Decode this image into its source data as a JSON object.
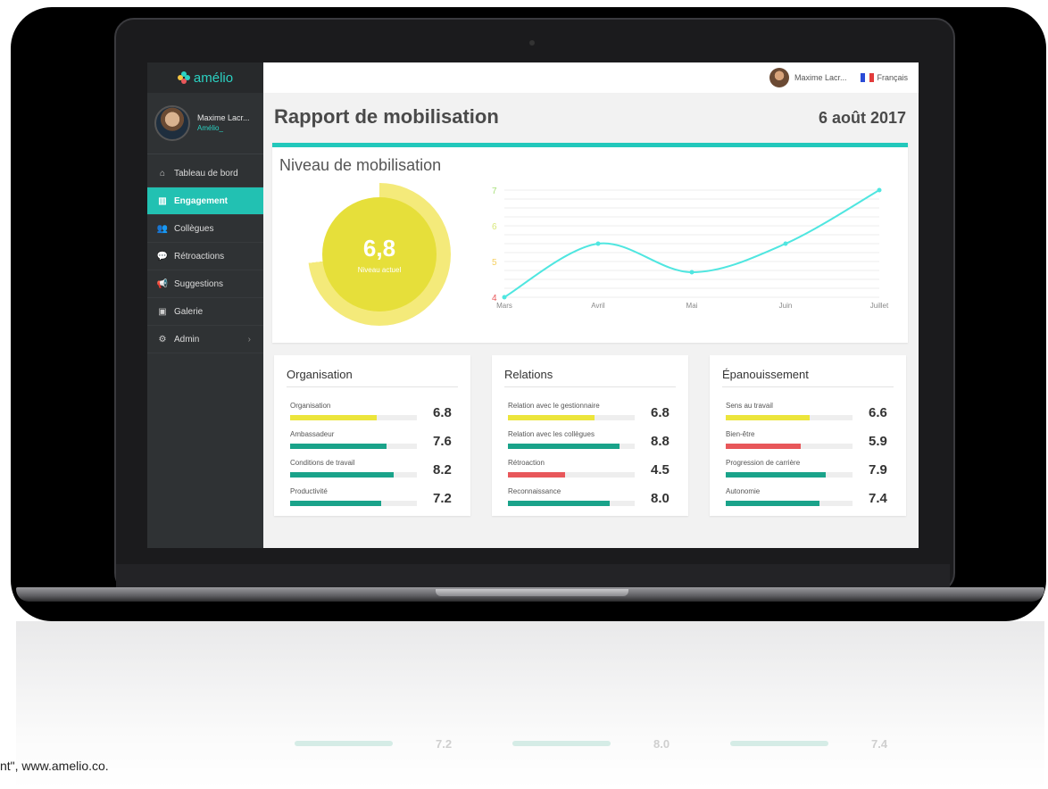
{
  "app": {
    "logo_text": "amélio"
  },
  "profile": {
    "name": "Maxime Lacr...",
    "org": "Amélio_"
  },
  "nav": [
    {
      "icon": "home-icon",
      "glyph": "⌂",
      "label": "Tableau de bord",
      "active": false
    },
    {
      "icon": "chart-icon",
      "glyph": "▥",
      "label": "Engagement",
      "active": true
    },
    {
      "icon": "users-icon",
      "glyph": "👥",
      "label": "Collègues",
      "active": false
    },
    {
      "icon": "comments-icon",
      "glyph": "💬",
      "label": "Rétroactions",
      "active": false
    },
    {
      "icon": "megaphone-icon",
      "glyph": "📢",
      "label": "Suggestions",
      "active": false
    },
    {
      "icon": "gallery-icon",
      "glyph": "▣",
      "label": "Galerie",
      "active": false
    },
    {
      "icon": "gear-icon",
      "glyph": "⚙",
      "label": "Admin",
      "active": false,
      "caret": "›"
    }
  ],
  "topbar": {
    "user": "Maxime Lacr...",
    "language": "Français"
  },
  "page": {
    "title": "Rapport de mobilisation",
    "date": "6 août 2017"
  },
  "mobilisation": {
    "heading": "Niveau de mobilisation",
    "current_value": "6,8",
    "current_label": "Niveau actuel",
    "gauge_fraction": 0.73
  },
  "chart_data": {
    "type": "line",
    "categories": [
      "Mars",
      "Avril",
      "Mai",
      "Juin",
      "Juillet"
    ],
    "values": [
      4.0,
      5.5,
      4.7,
      5.5,
      7.0
    ],
    "yticks": [
      "4",
      "5",
      "6",
      "7"
    ],
    "ylim": [
      4,
      7
    ],
    "grid": true,
    "colors": {
      "line": "#4fe6e0",
      "tick4": "#e8575a",
      "tick5": "#f5d060",
      "tick6": "#d8e87a",
      "tick7": "#a8e07a"
    }
  },
  "cards": [
    {
      "title": "Organisation",
      "items": [
        {
          "label": "Organisation",
          "value": "6.8",
          "fraction": 0.68,
          "color": "#ece53c"
        },
        {
          "label": "Ambassadeur",
          "value": "7.6",
          "fraction": 0.76,
          "color": "#1aa38a"
        },
        {
          "label": "Conditions de travail",
          "value": "8.2",
          "fraction": 0.82,
          "color": "#1aa38a"
        },
        {
          "label": "Productivité",
          "value": "7.2",
          "fraction": 0.72,
          "color": "#1aa38a"
        }
      ]
    },
    {
      "title": "Relations",
      "items": [
        {
          "label": "Relation avec le gestionnaire",
          "value": "6.8",
          "fraction": 0.68,
          "color": "#ece53c"
        },
        {
          "label": "Relation avec les collègues",
          "value": "8.8",
          "fraction": 0.88,
          "color": "#1aa38a"
        },
        {
          "label": "Rétroaction",
          "value": "4.5",
          "fraction": 0.45,
          "color": "#e8575a"
        },
        {
          "label": "Reconnaissance",
          "value": "8.0",
          "fraction": 0.8,
          "color": "#1aa38a"
        }
      ]
    },
    {
      "title": "Épanouissement",
      "items": [
        {
          "label": "Sens au travail",
          "value": "6.6",
          "fraction": 0.66,
          "color": "#ece53c"
        },
        {
          "label": "Bien-être",
          "value": "5.9",
          "fraction": 0.59,
          "color": "#e8575a"
        },
        {
          "label": "Progression de carrière",
          "value": "7.9",
          "fraction": 0.79,
          "color": "#1aa38a"
        },
        {
          "label": "Autonomie",
          "value": "7.4",
          "fraction": 0.74,
          "color": "#1aa38a"
        }
      ]
    }
  ],
  "caption": "nt\", www.amelio.co."
}
